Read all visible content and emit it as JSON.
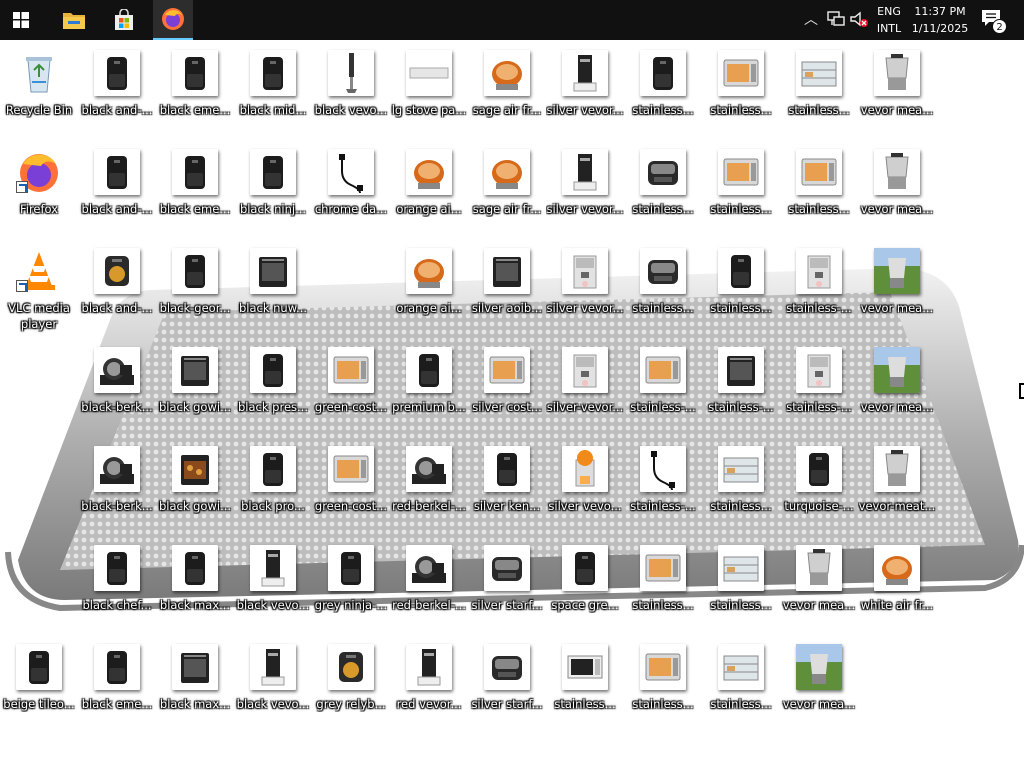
{
  "taskbar": {
    "language": "ENG",
    "layout": "INTL",
    "time": "11:37 PM",
    "date": "1/11/2025",
    "notification_count": "2"
  },
  "desktop": {
    "columns": [
      [
        {
          "label": "Recycle Bin",
          "icon": "recycle-bin-icon"
        },
        {
          "label": "Firefox",
          "icon": "firefox-icon",
          "shortcut": true
        },
        {
          "label": "VLC media player",
          "icon": "vlc-icon",
          "shortcut": true,
          "wrap": true
        },
        null,
        null,
        null,
        {
          "label": "beige tileo...",
          "icon": "air-fryer-icon"
        }
      ],
      [
        {
          "label": "black and-...",
          "icon": "air-fryer-icon"
        },
        {
          "label": "black and-...",
          "icon": "air-fryer-icon"
        },
        {
          "label": "black and-...",
          "icon": "air-fryer-basket-icon"
        },
        {
          "label": "black-berk...",
          "icon": "meat-slicer-icon"
        },
        {
          "label": "black-berk...",
          "icon": "meat-slicer-icon"
        },
        {
          "label": "black chef...",
          "icon": "air-fryer-icon"
        },
        {
          "label": "black eme...",
          "icon": "air-fryer-icon"
        }
      ],
      [
        {
          "label": "black eme...",
          "icon": "air-fryer-icon"
        },
        {
          "label": "black eme...",
          "icon": "air-fryer-icon"
        },
        {
          "label": "black-geor...",
          "icon": "air-fryer-icon"
        },
        {
          "label": "black gowi...",
          "icon": "air-fryer-oven-icon"
        },
        {
          "label": "black gowi...",
          "icon": "air-fryer-food-icon"
        },
        {
          "label": "black max...",
          "icon": "air-fryer-icon"
        },
        {
          "label": "black max...",
          "icon": "air-fryer-oven-icon"
        }
      ],
      [
        {
          "label": "black mid...",
          "icon": "air-fryer-icon"
        },
        {
          "label": "black ninj...",
          "icon": "air-fryer-icon"
        },
        {
          "label": "black nuw...",
          "icon": "air-fryer-oven-icon"
        },
        {
          "label": "black pres...",
          "icon": "air-fryer-icon"
        },
        {
          "label": "black pro...",
          "icon": "air-fryer-icon"
        },
        {
          "label": "black vevo...",
          "icon": "water-distiller-icon"
        },
        {
          "label": "black vevo...",
          "icon": "water-distiller-icon"
        }
      ],
      [
        {
          "label": "black vevo...",
          "icon": "immersion-blender-icon"
        },
        {
          "label": "chrome da...",
          "icon": "power-cord-icon"
        },
        null,
        {
          "label": "green-cost...",
          "icon": "toaster-oven-icon"
        },
        {
          "label": "green-cost...",
          "icon": "toaster-oven-icon"
        },
        {
          "label": "grey ninja-...",
          "icon": "air-fryer-icon"
        },
        {
          "label": "grey relyb...",
          "icon": "air-fryer-basket-icon"
        }
      ],
      [
        {
          "label": "lg stove pa...",
          "icon": "stove-panel-icon"
        },
        {
          "label": "orange ai...",
          "icon": "air-fryer-dome-icon"
        },
        {
          "label": "orange ai...",
          "icon": "air-fryer-dome-icon"
        },
        {
          "label": "premium b...",
          "icon": "air-fryer-icon"
        },
        {
          "label": "red-berkel-...",
          "icon": "meat-slicer-icon"
        },
        {
          "label": "red-berkel-...",
          "icon": "meat-slicer-icon"
        },
        {
          "label": "red vevor...",
          "icon": "water-distiller-icon"
        }
      ],
      [
        {
          "label": "sage air fr...",
          "icon": "air-fryer-dome-icon"
        },
        {
          "label": "sage air fr...",
          "icon": "air-fryer-dome-icon"
        },
        {
          "label": "silver aoib...",
          "icon": "air-fryer-oven-icon"
        },
        {
          "label": "silver cost...",
          "icon": "toaster-oven-icon"
        },
        {
          "label": "silver ken...",
          "icon": "air-fryer-icon"
        },
        {
          "label": "silver starf...",
          "icon": "grill-icon"
        },
        {
          "label": "silver starf...",
          "icon": "grill-icon"
        }
      ],
      [
        {
          "label": "silver vevor...",
          "icon": "water-distiller-icon"
        },
        {
          "label": "silver vevor...",
          "icon": "water-distiller-icon"
        },
        {
          "label": "silver vevor...",
          "icon": "ice-cream-machine-icon"
        },
        {
          "label": "silver-vevor...",
          "icon": "ice-cream-machine-icon"
        },
        {
          "label": "silver vevo...",
          "icon": "juicer-icon"
        },
        {
          "label": "space gre...",
          "icon": "air-fryer-icon"
        },
        {
          "label": "stainless...",
          "icon": "microwave-icon"
        }
      ],
      [
        {
          "label": "stainless...",
          "icon": "air-fryer-icon"
        },
        {
          "label": "stainless...",
          "icon": "grill-icon"
        },
        {
          "label": "stainless...",
          "icon": "grill-icon"
        },
        {
          "label": "stainless-...",
          "icon": "toaster-oven-icon"
        },
        {
          "label": "stainless-...",
          "icon": "power-cord-icon"
        },
        {
          "label": "stainless...",
          "icon": "toaster-oven-icon"
        },
        {
          "label": "stainless...",
          "icon": "toaster-oven-icon"
        }
      ],
      [
        {
          "label": "stainless...",
          "icon": "toaster-oven-icon"
        },
        {
          "label": "stainless...",
          "icon": "toaster-oven-icon"
        },
        {
          "label": "stainless...",
          "icon": "air-fryer-icon"
        },
        {
          "label": "stainless-...",
          "icon": "air-fryer-oven-icon"
        },
        {
          "label": "stainless...",
          "icon": "display-case-icon"
        },
        {
          "label": "stainless...",
          "icon": "display-case-icon"
        },
        {
          "label": "stainless...",
          "icon": "display-case-icon"
        }
      ],
      [
        {
          "label": "stainless...",
          "icon": "display-case-icon"
        },
        {
          "label": "stainless...",
          "icon": "toaster-oven-icon"
        },
        {
          "label": "stainless-...",
          "icon": "ice-cream-machine-icon"
        },
        {
          "label": "stainless-...",
          "icon": "ice-cream-machine-icon"
        },
        {
          "label": "turquoise-...",
          "icon": "air-fryer-icon"
        },
        {
          "label": "vevor mea...",
          "icon": "meat-processor-icon"
        },
        {
          "label": "vevor mea...",
          "icon": "meat-processor-photo-icon"
        }
      ],
      [
        {
          "label": "vevor mea...",
          "icon": "meat-processor-icon"
        },
        {
          "label": "vevor mea...",
          "icon": "meat-processor-icon"
        },
        {
          "label": "vevor mea...",
          "icon": "meat-processor-photo-icon"
        },
        {
          "label": "vevor mea...",
          "icon": "meat-processor-photo-icon"
        },
        {
          "label": "vevor-meat...",
          "icon": "meat-processor-icon"
        },
        {
          "label": "white air fr...",
          "icon": "air-fryer-dome-icon"
        },
        null
      ]
    ]
  }
}
